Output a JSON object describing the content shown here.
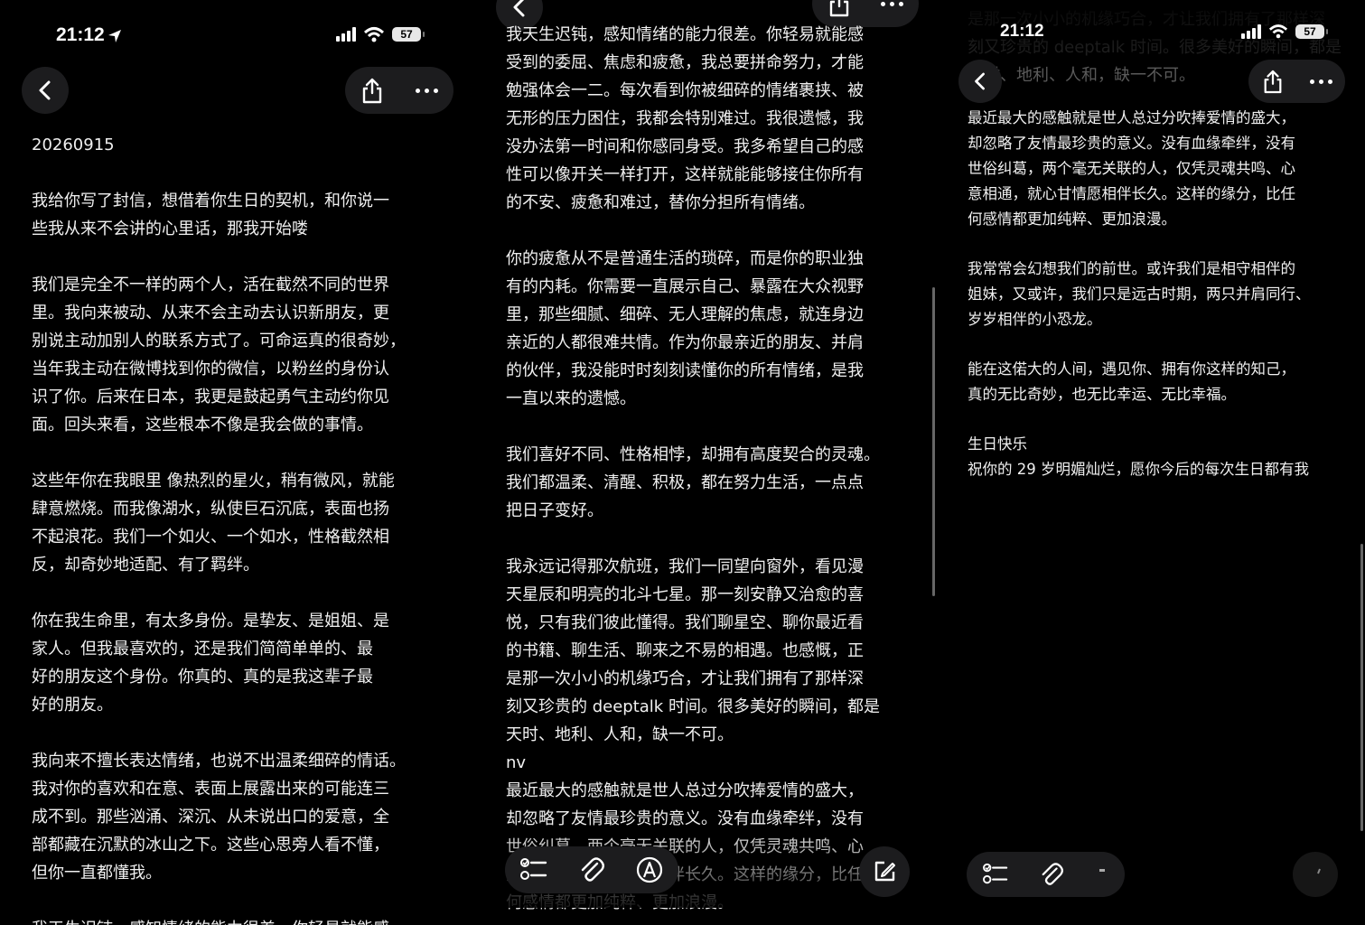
{
  "status": {
    "time": "21:12",
    "battery": "57"
  },
  "panel1": {
    "date": "20260915",
    "paragraphs": [
      "我给你写了封信，想借着你生日的契机，和你说一\n些我从来不会讲的心里话，那我开始喽",
      "我们是完全不一样的两个人，活在截然不同的世界\n里。我向来被动、从来不会主动去认识新朋友，更\n别说主动加别人的联系方式了。可命运真的很奇妙，\n当年我主动在微博找到你的微信，以粉丝的身份认\n识了你。后来在日本，我更是鼓起勇气主动约你见\n面。回头来看，这些根本不像是我会做的事情。",
      "这些年你在我眼里 像热烈的星火，稍有微风，就能\n肆意燃烧。而我像湖水，纵使巨石沉底，表面也扬\n不起浪花。我们一个如火、一个如水，性格截然相\n反，却奇妙地适配、有了羁绊。",
      "你在我生命里，有太多身份。是挚友、是姐姐、是\n家人。但我最喜欢的，还是我们简简单单的、最\n好的朋友这个身份。你真的、真的是我这辈子最\n好的朋友。",
      "我向来不擅长表达情绪，也说不出温柔细碎的情话。\n我对你的喜欢和在意、表面上展露出来的可能连三\n成不到。那些汹涌、深沉、从未说出口的爱意，全\n部都藏在沉默的冰山之下。这些心思旁人看不懂，\n但你一直都懂我。",
      "我天生迟钝，感知情绪的能力很差。你轻易就能感"
    ]
  },
  "panel2": {
    "paragraphs": [
      "我天生迟钝，感知情绪的能力很差。你轻易就能感\n受到的委屈、焦虑和疲惫，我总要拼命努力，才能\n勉强体会一二。每次看到你被细碎的情绪裹挟、被\n无形的压力困住，我都会特别难过。我很遗憾，我\n没办法第一时间和你感同身受。我多希望自己的感\n性可以像开关一样打开，这样就能能够接住你所有\n的不安、疲惫和难过，替你分担所有情绪。",
      "你的疲惫从不是普通生活的琐碎，而是你的职业独\n有的内耗。你需要一直展示自己、暴露在大众视野\n里，那些细腻、细碎、无人理解的焦虑，就连身边\n亲近的人都很难共情。作为你最亲近的朋友、并肩\n的伙伴，我没能时时刻刻读懂你的所有情绪，是我\n一直以来的遗憾。",
      "我们喜好不同、性格相悖，却拥有高度契合的灵魂。\n我们都温柔、清醒、积极，都在努力生活，一点点\n把日子变好。",
      "我永远记得那次航班，我们一同望向窗外，看见漫\n天星辰和明亮的北斗七星。那一刻安静又治愈的喜\n悦，只有我们彼此懂得。我们聊星空、聊你最近看\n的书籍、聊生活、聊来之不易的相遇。也感慨，正\n是那一次小小的机缘巧合，才让我们拥有了那样深\n刻又珍贵的 deeptalk 时间。很多美好的瞬间，都是\n天时、地利、人和，缺一不可。",
      "nv",
      "最近最大的感触就是世人总过分吹捧爱情的盛大，\n却忽略了友情最珍贵的意义。没有血缘牵绊，没有\n世俗纠葛，两个毫无关联的人，仅凭灵魂共鸣、心\n意相通，就心甘情愿相伴长久。这样的缘分，比任\n何感情都更加纯粹、更加浪漫。"
    ]
  },
  "panel3": {
    "top_fragment": "是那一次小小的机缘巧合，才让我们拥有了那样深\n刻又珍贵的 deeptalk 时间。很多美好的瞬间，都是\n天时、地利、人和，缺一不可。",
    "paragraphs": [
      "最近最大的感触就是世人总过分吹捧爱情的盛大，\n却忽略了友情最珍贵的意义。没有血缘牵绊，没有\n世俗纠葛，两个毫无关联的人，仅凭灵魂共鸣、心\n意相通，就心甘情愿相伴长久。这样的缘分，比任\n何感情都更加纯粹、更加浪漫。",
      "我常常会幻想我们的前世。或许我们是相守相伴的\n姐妹，又或许，我们只是远古时期，两只并肩同行、\n岁岁相伴的小恐龙。",
      "能在这偌大的人间，遇见你、拥有你这样的知己，\n真的无比奇妙，也无比幸运、无比幸福。",
      "生日快乐\n祝你的 29 岁明媚灿烂，愿你今后的每次生日都有我"
    ]
  },
  "icons": {
    "back": "chevron-left-icon",
    "share": "share-icon",
    "more": "ellipsis-icon",
    "checklist": "checklist-icon",
    "attach": "paperclip-icon",
    "markup": "markup-pen-icon",
    "compose": "compose-icon"
  }
}
